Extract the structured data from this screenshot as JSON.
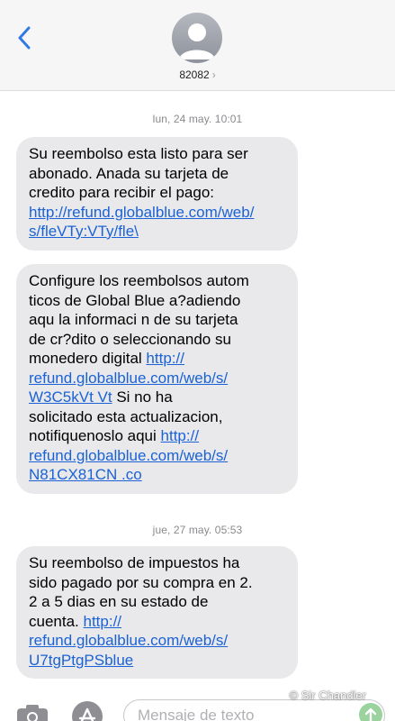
{
  "header": {
    "contact_name": "82082",
    "chevron": "›",
    "back_icon": "chevron-left-icon",
    "avatar_icon": "person-avatar-icon"
  },
  "colors": {
    "link": "#1a62d6",
    "bubble": "#e9e9eb",
    "back": "#2f7ae5"
  },
  "timestamps": [
    {
      "day": "lun, 24 may.",
      "time": "10:01"
    },
    {
      "day": "jue, 27 may.",
      "time": "05:53"
    }
  ],
  "messages": [
    {
      "lines": [
        "Su reembolso esta listo para ser",
        "abonado. Anada su tarjeta de",
        "credito para recibir el pago:"
      ],
      "link": [
        "http://refund.globalblue.com/web/",
        "s/fleVTy:VTy/fle\\"
      ]
    },
    {
      "lines": [
        "Configure los reembolsos autom",
        "ticos de Global Blue a?adiendo",
        "aqu  la informaci n de su tarjeta",
        "de cr?dito o seleccionando su"
      ],
      "line5_text": "monedero digital ",
      "line5_link": "http://",
      "link_a": [
        "refund.globalblue.com/web/s/",
        "W3C5kVt Vt"
      ],
      "after_link_a": " Si no ha",
      "lines_b": [
        "solicitado esta actualizacion,"
      ],
      "line_b2_text": "notifiquenoslo aqui ",
      "line_b2_link": "http://",
      "link_b": [
        "refund.globalblue.com/web/s/",
        "N81CX81CN .co"
      ]
    },
    {
      "lines": [
        "Su reembolso de impuestos ha",
        "sido pagado por su compra en 2.",
        "2 a 5 dias en su estado de"
      ],
      "line4_text": "cuenta. ",
      "line4_link": "http://",
      "link": [
        "refund.globalblue.com/web/s/",
        "U7tgPtgPSblue"
      ]
    }
  ],
  "composer": {
    "placeholder": "Mensaje de texto",
    "camera_icon": "camera-icon",
    "apps_icon": "app-store-icon",
    "send_icon": "send-arrow-icon"
  },
  "watermark": "© Sir Chandler"
}
